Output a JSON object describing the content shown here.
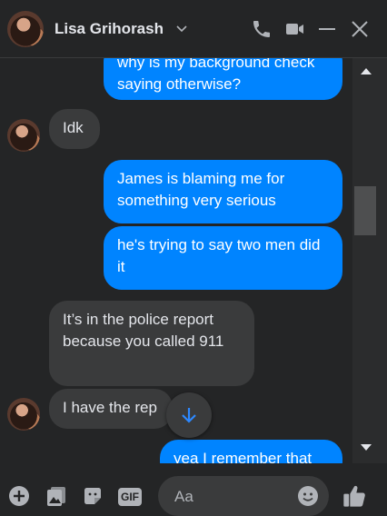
{
  "header": {
    "contact_name": "Lisa Grihorash",
    "icons": [
      "chevron-down-icon",
      "phone-icon",
      "video-camera-icon",
      "minimize-icon",
      "close-icon"
    ]
  },
  "messages": [
    {
      "side": "outgoing",
      "text": "why is my background check saying otherwise?"
    },
    {
      "side": "incoming",
      "text": "Idk"
    },
    {
      "side": "outgoing",
      "text": "James is blaming me for something very serious"
    },
    {
      "side": "outgoing",
      "text": "he's trying to say two men did it"
    },
    {
      "side": "incoming",
      "text": "It’s in the police report because you called 911"
    },
    {
      "side": "incoming",
      "text": "I have the rep"
    },
    {
      "side": "outgoing",
      "text": "yea I remember that"
    }
  ],
  "composer": {
    "placeholder": "Aa",
    "gif_label": "GIF",
    "icons": [
      "add-icon",
      "image-icon",
      "sticker-icon",
      "gif-icon",
      "emoji-icon",
      "thumbs-up-icon"
    ]
  },
  "colors": {
    "background": "#242526",
    "outgoing_bubble": "#0084ff",
    "incoming_bubble": "#3a3b3c",
    "text": "#e4e6eb",
    "icon": "#b0b3b8"
  }
}
